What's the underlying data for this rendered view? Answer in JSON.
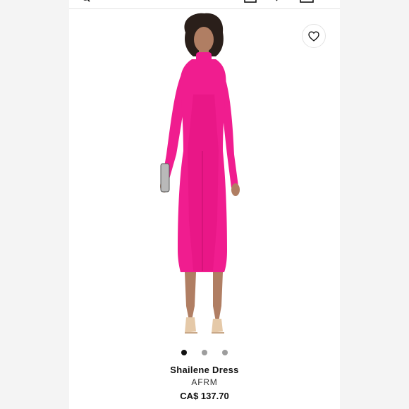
{
  "product": {
    "name": "Shailene Dress",
    "brand": "AFRM",
    "price": "CA$ 137.70"
  },
  "icons": {
    "search": "search-icon",
    "account": "account-icon",
    "bag": "shopping-bag-icon",
    "favorite": "heart-icon"
  },
  "gallery": {
    "image_count": 3,
    "active_index": 0
  },
  "colors": {
    "dress": "#f01d8f",
    "dress_shadow": "#c4106f",
    "skin": "#b07e63",
    "hair": "#2a1f1a"
  }
}
